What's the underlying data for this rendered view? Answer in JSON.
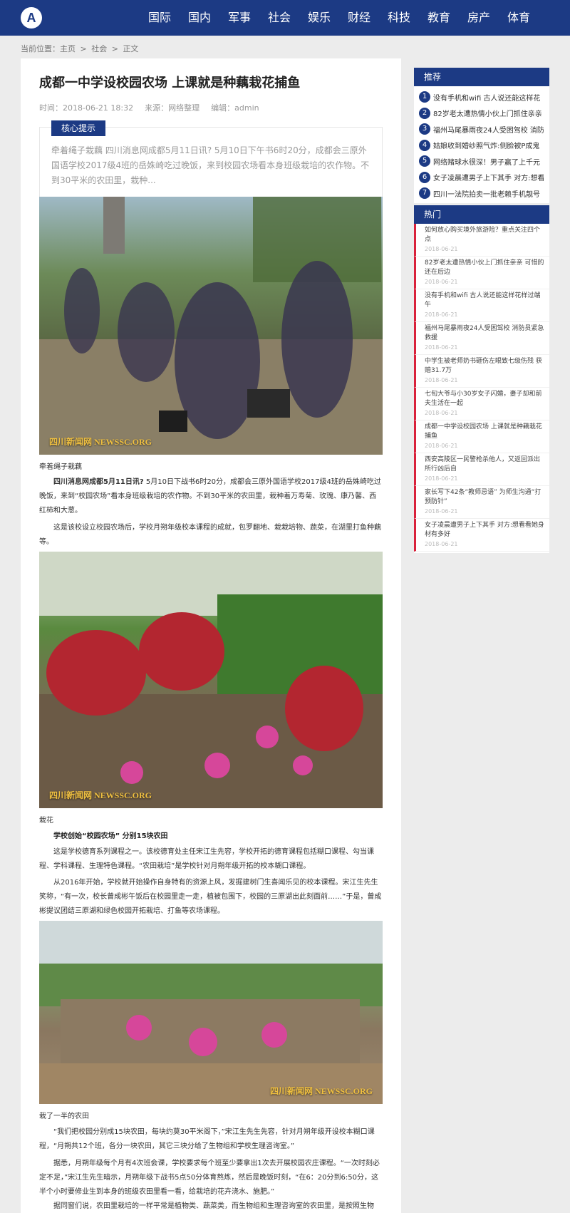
{
  "header": {
    "logo_icon": "A",
    "nav": [
      "国际",
      "国内",
      "军事",
      "社会",
      "娱乐",
      "财经",
      "科技",
      "教育",
      "房产",
      "体育"
    ]
  },
  "breadcrumb": [
    "当前位置：主页",
    ">",
    "社会",
    ">",
    "正文"
  ],
  "article": {
    "title": "成都一中学设校园农场 上课就是种藕栽花捕鱼",
    "time": "时间：2018-06-21 18:32",
    "source": "来源：网络整理",
    "editor": "编辑：admin",
    "abstract_tag": "核心提示",
    "abstract": "牵着绳子栽藕 四川消息网成都5月11日讯? 5月10日下午书6时20分，成都会三原外国语学校2017级4班的岳姝崎吃过晚饭，来到校园农场看本身班级栽培的农作物。不到30平米的农田里，栽种...",
    "photo1_watermark": "四川新闻网 NEWSSC.ORG",
    "caption1": "牵着绳子栽藕",
    "para1_lead": "四川消息网成都5月11日讯?",
    "para1": " 5月10日下战书6时20分，成都会三原外国语学校2017级4班的岳姝崎吃过晚饭，来到“校园农场”看本身班级栽培的农作物。不到30平米的农田里，栽种着万寿菊、玫瑰、康乃馨、西红柿和大葱。",
    "para2": "这是该校设立校园农场后，学校月朔年级校本课程的成就，包罗翻地、栽栽培物、蔬菜，在湖里打鱼种藕等。",
    "photo2_watermark": "四川新闻网 NEWSSC.ORG",
    "caption2": "栽花",
    "subhead": "学校创始“校园农场” 分别15块农田",
    "para3": "这是学校德育系列课程之一。该校德育处主任宋江生先容，学校开拓的德育课程包括糊口课程、勾当课程、学科课程、生理特色课程。“农田栽培”是学校针对月朔年级开拓的校本糊口课程。",
    "para4": "从2016年开始，学校就开始操作自身特有的资源上风，发掘建树门生喜闻乐见的校本课程。宋江生先生笑称，“有一次，校长曾成彬午饭后在校园里走一走，植被包围下，校园的三原湖出此刻面前……”于是，曾成彬提议团结三原湖和绿色校园开拓栽培、打鱼等农场课程。",
    "photo3_watermark": "四川新闻网 NEWSSC.ORG",
    "caption3": "栽了一半的农田",
    "para5": "“我们把校园分别成15块农田，每块约莫30平米阁下，”宋江生先生先容，针对月朔年级开设校本糊口课程，“月朔共12个班，各分一块农田，其它三块分给了生物组和学校生理咨询室。”",
    "para6": "据悉，月朔年级每个月有4次班会课，学校要求每个班至少要拿出1次去开展校园农庄课程。“一次时刻必定不足，”宋江生先生暗示，月朔年级下战书5点50分体育熬炼，然后是晚饭时刻，“在6：20分到6:50分，这半个小时要修业生到本身的班级农田里看一看，给栽培的花卉浇水、施肥。”",
    "para7": "据同窗们说，农田里栽培的一样平常是植物类、蔬菜类，而生物组和生理咨询室的农田里，是按照生物"
  },
  "sidebar": {
    "recommend_title": "推荐",
    "recommend": [
      {
        "num": "1",
        "text": "没有手机和wifi 古人说还能这样花"
      },
      {
        "num": "2",
        "text": "82岁老太遭热情小伙上门抓住亲亲"
      },
      {
        "num": "3",
        "text": "福州马尾暴雨夜24人受困驾校 消防"
      },
      {
        "num": "4",
        "text": "姑娘收到婚纱照气炸:侧脸被P成鬼"
      },
      {
        "num": "5",
        "text": "网络赌球水很深！男子赢了上千元"
      },
      {
        "num": "6",
        "text": "女子凌晨遭男子上下其手 对方:想看"
      },
      {
        "num": "7",
        "text": "四川一法院拍卖一批老赖手机靓号"
      }
    ],
    "hot_title": "热门",
    "hot": [
      {
        "title": "如何放心购买境外旅游险？重点关注四个点",
        "date": "2018-06-21"
      },
      {
        "title": "82岁老太遭热情小伙上门抓住亲亲 可惜的还在后边",
        "date": "2018-06-21"
      },
      {
        "title": "没有手机和wifi 古人说还能这样花样过端午",
        "date": "2018-06-21"
      },
      {
        "title": "福州马尾暴雨夜24人受困驾校 消防员紧急救援",
        "date": "2018-06-21"
      },
      {
        "title": "中学生被老师奶书砸伤左眼致七级伤残 获赔31.7万",
        "date": "2018-06-21"
      },
      {
        "title": "七旬大爷与小30岁女子闪婚，妻子却和前夫生活在一起",
        "date": "2018-06-21"
      },
      {
        "title": "成都一中学设校园农场 上课就是种藕栽花捕鱼",
        "date": "2018-06-21"
      },
      {
        "title": "西安高陵区一民警枪杀他人，又返回派出所行凶后自",
        "date": "2018-06-21"
      },
      {
        "title": "家长写下42条“教师忌语” 为师生沟通“打预防针”",
        "date": "2018-06-21"
      },
      {
        "title": "女子凌晨遭男子上下其手 对方:想看看她身材有多好",
        "date": "2018-06-21"
      }
    ]
  },
  "colors": {
    "brand": "#1c3a84",
    "accent_red": "#d9213b"
  }
}
